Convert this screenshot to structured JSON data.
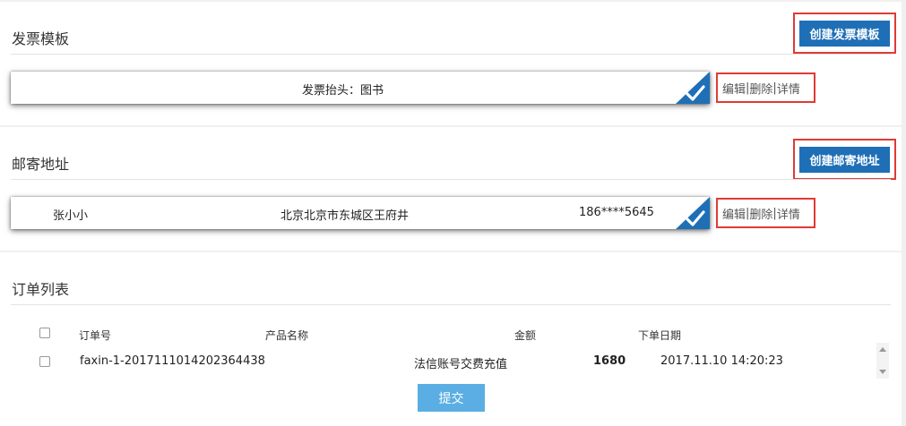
{
  "invoice_section": {
    "title": "发票模板",
    "create_label": "创建发票模板",
    "card_text": "发票抬头：图书",
    "actions": {
      "edit": "编辑",
      "delete": "删除",
      "detail": "详情",
      "sep": "|"
    }
  },
  "address_section": {
    "title": "邮寄地址",
    "create_label": "创建邮寄地址",
    "name": "张小小",
    "address": "北京北京市东城区王府井",
    "phone": "186****5645",
    "actions": {
      "edit": "编辑",
      "delete": "删除",
      "detail": "详情",
      "sep": "|"
    }
  },
  "orders_section": {
    "title": "订单列表",
    "headers": {
      "order_no": "订单号",
      "product": "产品名称",
      "amount": "金额",
      "date": "下单日期"
    },
    "rows": [
      {
        "order_no": "faxin-1-201711101420236443​8",
        "product": "法信账号交费充值",
        "amount": "1680",
        "date": "2017.11.10 14:20:23",
        "checked": false
      }
    ],
    "submit_label": "提交"
  },
  "colors": {
    "primary": "#1f6fb7",
    "highlight_border": "#e03a36",
    "submit": "#5aaee3"
  }
}
